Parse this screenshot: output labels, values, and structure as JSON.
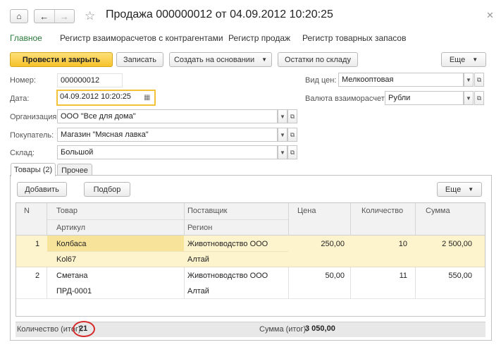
{
  "window": {
    "title": "Продажа 000000012 от 04.09.2012 10:20:25"
  },
  "nav": {
    "items": [
      {
        "label": "Главное"
      },
      {
        "label": "Регистр взаиморасчетов с контрагентами"
      },
      {
        "label": "Регистр продаж"
      },
      {
        "label": "Регистр товарных запасов"
      }
    ]
  },
  "toolbar": {
    "post_close": "Провести и закрыть",
    "save": "Записать",
    "create_based": "Создать на основании",
    "stock": "Остатки по складу",
    "more": "Еще"
  },
  "form": {
    "number_label": "Номер:",
    "number_value": "000000012",
    "date_label": "Дата:",
    "date_value": "04.09.2012 10:20:25",
    "org_label": "Организация:",
    "org_value": "ООО \"Все для дома\"",
    "buyer_label": "Покупатель:",
    "buyer_value": "Магазин \"Мясная лавка\"",
    "warehouse_label": "Склад:",
    "warehouse_value": "Большой",
    "price_type_label": "Вид цен:",
    "price_type_value": "Мелкооптовая",
    "currency_label": "Валюта взаиморасчетов:",
    "currency_value": "Рубли"
  },
  "tabs": [
    {
      "label": "Товары (2)"
    },
    {
      "label": "Прочее"
    }
  ],
  "table_toolbar": {
    "add": "Добавить",
    "pick": "Подбор",
    "more": "Еще"
  },
  "table": {
    "headers": {
      "n": "N",
      "product": "Товар",
      "article": "Артикул",
      "supplier": "Поставщик",
      "region": "Регион",
      "price": "Цена",
      "qty": "Количество",
      "sum": "Сумма"
    },
    "rows": [
      {
        "n": "1",
        "product": "Колбаса",
        "article": "Kol67",
        "supplier": "Животноводство ООО",
        "region": "Алтай",
        "price": "250,00",
        "qty": "10",
        "sum": "2 500,00"
      },
      {
        "n": "2",
        "product": "Сметана",
        "article": "ПРД-0001",
        "supplier": "Животноводство ООО",
        "region": "Алтай",
        "price": "50,00",
        "qty": "11",
        "sum": "550,00"
      }
    ]
  },
  "footer": {
    "qty_label": "Количество (итог):",
    "qty_total": "21",
    "sum_label": "Сумма (итог):",
    "sum_total": "3 050,00"
  },
  "colors": {
    "accent_yellow": "#f5c22b",
    "active_nav_green": "#2a7a3a",
    "selected_row": "#fdf3cc",
    "annotation_red": "#d62a2a"
  }
}
